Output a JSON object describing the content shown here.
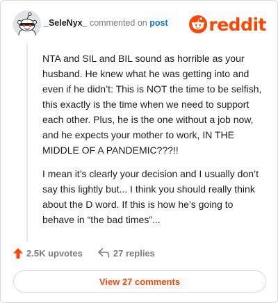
{
  "comment": {
    "username": "_SeleNyx_",
    "commented_on_text": "commented on",
    "post_link": "post",
    "paragraphs": [
      "NTA and SIL and BIL sound as horrible as your husband. He knew what he was getting into and even if he didn’t: This is NOT the time to be selfish, this exactly is the time when we need to support each other. Plus, he is the one without a job now, and he expects your mother to work, IN THE MIDDLE OF A PANDEMIC???!!",
      "I mean it’s clearly your decision and I usually don’t say this lightly but... I think you should really think about the D word. If this is how he’s going to behave in “the bad times”..."
    ]
  },
  "brand": {
    "wordmark": "reddit",
    "color": "#ff4500"
  },
  "actions": {
    "upvotes": "2.5K upvotes",
    "replies": "27 replies",
    "view_button": "View 27 comments"
  },
  "icons": {
    "avatar": "snoo-avatar-icon",
    "logo": "reddit-snoo-icon",
    "upvote": "upvote-arrow-icon",
    "reply": "reply-arrow-icon"
  }
}
